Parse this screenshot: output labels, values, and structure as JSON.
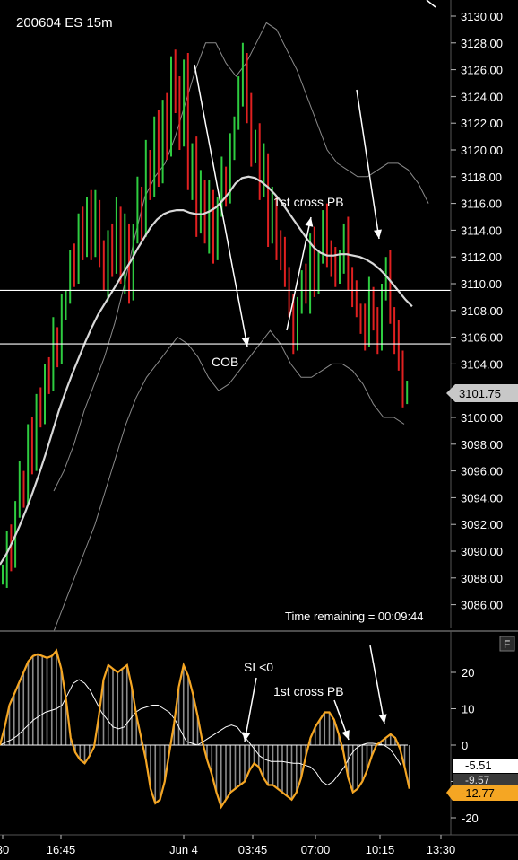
{
  "chart_title": "200604 ES 15m",
  "time_remaining": "Time remaining = 00:09:44",
  "price_axis": {
    "ticks": [
      3130,
      3128,
      3126,
      3124,
      3122,
      3120,
      3118,
      3116,
      3114,
      3112,
      3110,
      3108,
      3106,
      3104,
      3102,
      3100,
      3098,
      3096,
      3094,
      3092,
      3090,
      3088,
      3086
    ],
    "tick_labels": [
      "3130.00",
      "3128.00",
      "3126.00",
      "3124.00",
      "3122.00",
      "3120.00",
      "3118.00",
      "3116.00",
      "3114.00",
      "3112.00",
      "3110.00",
      "3108.00",
      "3106.00",
      "3104.00",
      "3102.00",
      "3100.00",
      "3098.00",
      "3096.00",
      "3094.00",
      "3092.00",
      "3090.00",
      "3088.00",
      "3086.00"
    ],
    "current_price_label": "3101.75"
  },
  "time_axis": {
    "labels": [
      "30",
      "16:45",
      "Jun 4",
      "03:45",
      "07:00",
      "10:15",
      "13:30"
    ]
  },
  "price_annotations": {
    "cob": "COB",
    "first_cross_pb": "1st cross PB"
  },
  "horizontal_levels": [
    3109.5,
    3105.5
  ],
  "indicator": {
    "panel_button": "F",
    "ticks": [
      20,
      10,
      0,
      -10,
      -20
    ],
    "tick_labels": [
      "20",
      "10",
      "0",
      "-10",
      "-20"
    ],
    "value_labels": [
      "-5.51",
      "-9.57",
      "-12.77"
    ],
    "annotation_sl": "SL<0",
    "annotation_cross": "1st cross PB"
  },
  "colors": {
    "background": "#000000",
    "up_bar": "#2ecc40",
    "down_bar": "#e02020",
    "moving_average": "#d8d8d8",
    "envelope": "#8a8a8a",
    "oscillator": "#f5a623",
    "signal": "#ffffff",
    "grid": "#ffffff"
  },
  "chart_data": [
    {
      "type": "ohlc",
      "title": "200604 ES 15m",
      "ylim": [
        3084,
        3131
      ],
      "series": [
        {
          "name": "",
          "kind": "ohlc",
          "close": [
            3088.5,
            3090.5,
            3089.5,
            3093.0,
            3095.5,
            3094.5,
            3098.5,
            3096.5,
            3101.0,
            3100.5,
            3103.5,
            3102.5,
            3106.0,
            3105.0,
            3108.0,
            3109.0,
            3111.5,
            3111.0,
            3114.5,
            3112.5,
            3116.0,
            3113.0,
            3115.5,
            3112.0,
            3110.0,
            3113.5,
            3111.5,
            3115.0,
            3110.5,
            3114.0,
            3109.5,
            3113.5,
            3116.5,
            3114.5,
            3119.5,
            3117.0,
            3121.5,
            3118.5,
            3123.0,
            3120.0,
            3126.5,
            3124.0,
            3121.0,
            3126.0,
            3117.5,
            3120.0,
            3114.5,
            3117.0,
            3113.5,
            3116.5,
            3112.5,
            3115.5,
            3118.0,
            3117.0,
            3120.0,
            3122.0,
            3124.5,
            3126.5,
            3123.0,
            3119.5,
            3121.0,
            3117.5,
            3119.0,
            3113.5,
            3116.0,
            3113.0,
            3112.0,
            3110.5,
            3108.0,
            3106.0,
            3108.5,
            3110.0,
            3109.0,
            3113.0,
            3110.0,
            3112.0,
            3114.5,
            3112.5,
            3111.5,
            3110.5,
            3112.0,
            3113.5,
            3110.5,
            3109.0,
            3108.0,
            3107.5,
            3106.0,
            3109.0,
            3107.0,
            3106.0,
            3109.5,
            3111.0,
            3107.5,
            3106.0,
            3104.5,
            3101.5,
            3101.75
          ]
        },
        {
          "name": "",
          "kind": "moving_average",
          "values": [
            3089.0,
            3089.8,
            3090.8,
            3091.9,
            3093.1,
            3094.4,
            3095.8,
            3097.3,
            3098.9,
            3100.5,
            3101.9,
            3103.2,
            3104.4,
            3105.6,
            3106.7,
            3107.7,
            3108.5,
            3109.3,
            3110.1,
            3110.9,
            3111.7,
            3112.6,
            3113.4,
            3114.2,
            3114.8,
            3115.2,
            3115.4,
            3115.5,
            3115.5,
            3115.3,
            3115.2,
            3115.2,
            3115.4,
            3115.7,
            3116.2,
            3116.8,
            3117.5,
            3117.9,
            3118.0,
            3117.9,
            3117.6,
            3117.2,
            3116.7,
            3116.1,
            3115.4,
            3114.7,
            3114.0,
            3113.3,
            3112.7,
            3112.3,
            3112.1,
            3112.1,
            3112.2,
            3112.2,
            3112.1,
            3112.0,
            3111.8,
            3111.5,
            3111.1,
            3110.6,
            3110.0,
            3109.4,
            3108.8,
            3108.3
          ]
        },
        {
          "name": "",
          "kind": "envelope_upper",
          "values": [
            3094.5,
            3096.0,
            3098.0,
            3100.5,
            3102.5,
            3104.5,
            3107.0,
            3110.0,
            3113.5,
            3116.5,
            3118.0,
            3119.0,
            3121.0,
            3123.5,
            3126.0,
            3128.0,
            3128.0,
            3126.5,
            3125.5,
            3126.5,
            3128.0,
            3129.5,
            3129.0,
            3127.5,
            3126.0,
            3124.0,
            3122.0,
            3120.0,
            3119.0,
            3118.5,
            3118.0,
            3118.0,
            3118.5,
            3119.0,
            3119.0,
            3118.5,
            3117.5,
            3116.0
          ]
        },
        {
          "name": "",
          "kind": "envelope_lower",
          "values": [
            3084.0,
            3086.0,
            3088.0,
            3090.0,
            3092.0,
            3094.5,
            3097.0,
            3099.5,
            3101.5,
            3103.0,
            3104.0,
            3105.0,
            3106.0,
            3105.5,
            3104.5,
            3103.0,
            3102.0,
            3102.5,
            3103.5,
            3104.5,
            3105.5,
            3106.5,
            3105.5,
            3104.0,
            3103.0,
            3103.0,
            3103.5,
            3104.0,
            3104.0,
            3103.5,
            3102.5,
            3101.0,
            3100.0,
            3100.0,
            3099.5
          ]
        }
      ]
    },
    {
      "type": "line",
      "ylim": [
        -22,
        27
      ],
      "series": [
        {
          "name": "",
          "kind": "oscillator",
          "values": [
            0,
            5,
            11,
            14,
            17,
            20,
            23,
            24.5,
            25,
            24.5,
            24,
            24.5,
            26,
            21,
            13,
            2,
            -2,
            -4,
            -5,
            -3,
            -0.5,
            8,
            18,
            22,
            21,
            20,
            21,
            22,
            16,
            8,
            2,
            -4,
            -12,
            -16,
            -15,
            -10,
            -2,
            6,
            16,
            22,
            19,
            14,
            8,
            1,
            -4,
            -8,
            -13,
            -17,
            -15,
            -13,
            -12,
            -11,
            -10,
            -7,
            -5,
            -6,
            -9,
            -11,
            -11,
            -12,
            -13,
            -14,
            -15,
            -13,
            -9,
            -3,
            2,
            5,
            7,
            9,
            9,
            7,
            3,
            -2,
            -9,
            -13,
            -12,
            -10,
            -7,
            -3,
            0,
            1,
            2,
            3,
            2,
            -1,
            -6,
            -12
          ]
        },
        {
          "name": "",
          "kind": "signal",
          "values": [
            0,
            0.8,
            1.5,
            2.5,
            4,
            5.5,
            7,
            8,
            9,
            9.5,
            10,
            11,
            14,
            17,
            18,
            17,
            15,
            12,
            9,
            7,
            5,
            4.5,
            5,
            7,
            9,
            10,
            10.5,
            11,
            11,
            10,
            9,
            7,
            4,
            1,
            0.5,
            0,
            1,
            2,
            3,
            4,
            5,
            5.5,
            5,
            3,
            1,
            -1,
            -3,
            -4,
            -4.5,
            -4.5,
            -4.5,
            -4.8,
            -5,
            -5,
            -5.5,
            -6,
            -7.5,
            -10,
            -11,
            -10,
            -8,
            -6,
            -3,
            -1,
            0,
            0.5,
            0.5,
            0.3,
            0,
            -1,
            -3,
            -5.5
          ]
        }
      ]
    }
  ]
}
